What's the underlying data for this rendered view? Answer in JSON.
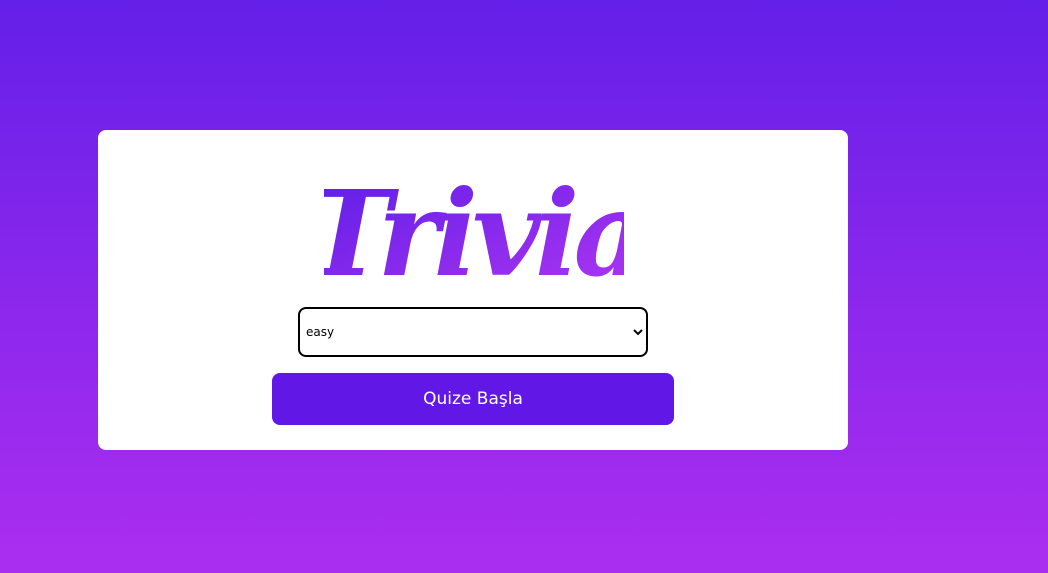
{
  "logo": {
    "text": "Trivia",
    "gradient_start": "#5a1de6",
    "gradient_end": "#b236f2"
  },
  "difficulty": {
    "selected": "easy",
    "options": [
      "easy"
    ]
  },
  "start_button": {
    "label": "Quize Başla",
    "color": "#6118e6"
  },
  "colors": {
    "background_top": "#641fe8",
    "background_bottom": "#ab2ef0",
    "card": "#ffffff"
  }
}
